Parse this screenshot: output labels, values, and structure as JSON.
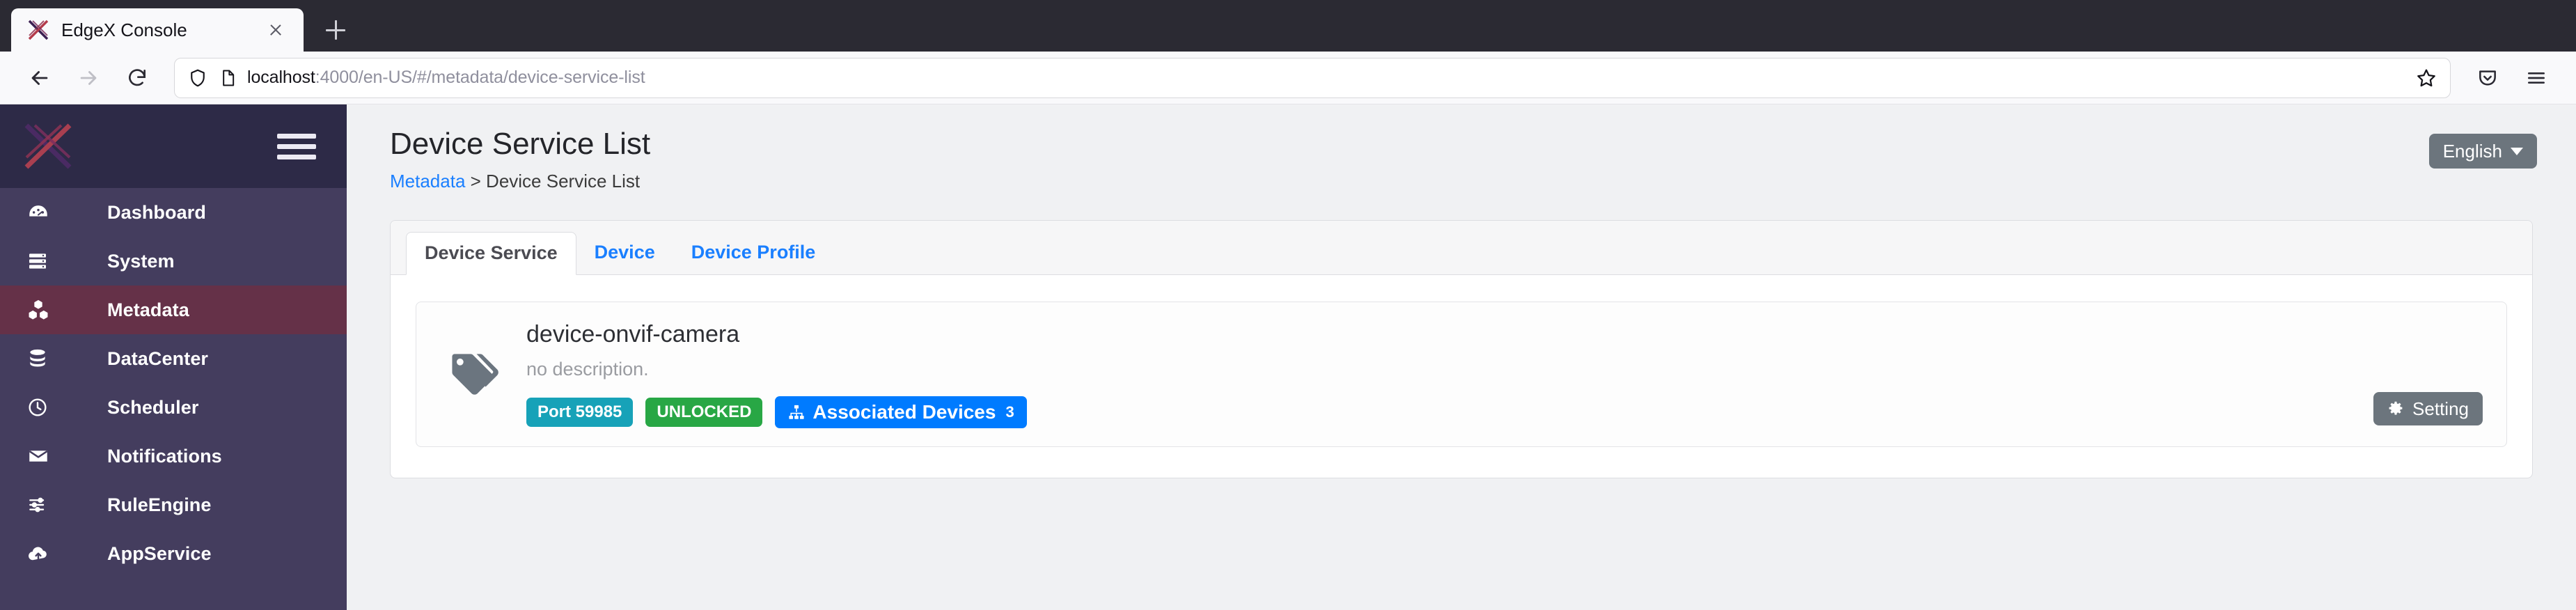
{
  "browser": {
    "tab": {
      "title": "EdgeX Console",
      "favicon_icon": "edgex-x-logo-icon",
      "close_icon": "close-icon"
    },
    "new_tab_icon": "plus-icon",
    "nav": {
      "back_icon": "back-arrow-icon",
      "forward_icon": "forward-arrow-icon",
      "reload_icon": "reload-icon",
      "shield_icon": "shield-icon",
      "page_icon": "page-document-icon",
      "bookmark_icon": "star-icon",
      "pocket_icon": "pocket-save-icon",
      "menu_icon": "hamburger-menu-icon"
    },
    "url": {
      "host": "localhost",
      "rest": ":4000/en-US/#/metadata/device-service-list",
      "full": "localhost:4000/en-US/#/metadata/device-service-list"
    }
  },
  "sidebar": {
    "brand_icon": "edgex-x-logo-icon",
    "toggle_icon": "hamburger-menu-icon",
    "active_color": "#653148",
    "background": "#443d5e",
    "header_background": "#2d2a47",
    "items": [
      {
        "label": "Dashboard",
        "icon": "dashboard-gauge-icon",
        "active": false
      },
      {
        "label": "System",
        "icon": "server-rack-icon",
        "active": false
      },
      {
        "label": "Metadata",
        "icon": "boxes-cubes-icon",
        "active": true
      },
      {
        "label": "DataCenter",
        "icon": "database-icon",
        "active": false
      },
      {
        "label": "Scheduler",
        "icon": "clock-icon",
        "active": false
      },
      {
        "label": "Notifications",
        "icon": "envelope-icon",
        "active": false
      },
      {
        "label": "RuleEngine",
        "icon": "sliders-icon",
        "active": false
      },
      {
        "label": "AppService",
        "icon": "cloud-upload-icon",
        "active": false
      }
    ]
  },
  "header": {
    "title": "Device Service List",
    "breadcrumb_link": "Metadata",
    "breadcrumb_separator": ">",
    "breadcrumb_current": "Device Service List",
    "language_label": "English",
    "language_caret_icon": "chevron-down-icon"
  },
  "main": {
    "tabs": [
      {
        "label": "Device Service",
        "active": true
      },
      {
        "label": "Device",
        "active": false
      },
      {
        "label": "Device Profile",
        "active": false
      }
    ],
    "services": [
      {
        "icon": "tags-icon",
        "name": "device-onvif-camera",
        "description": "no description.",
        "badges": [
          {
            "label": "Port 59985",
            "color": "#17a2b8",
            "icon": null
          },
          {
            "label": "UNLOCKED",
            "color": "#28a745",
            "icon": null
          },
          {
            "label": "Associated Devices",
            "color": "#007bff",
            "icon": "sitemap-icon",
            "count": "3"
          }
        ],
        "setting_label": "Setting",
        "setting_icon": "gear-icon"
      }
    ]
  }
}
